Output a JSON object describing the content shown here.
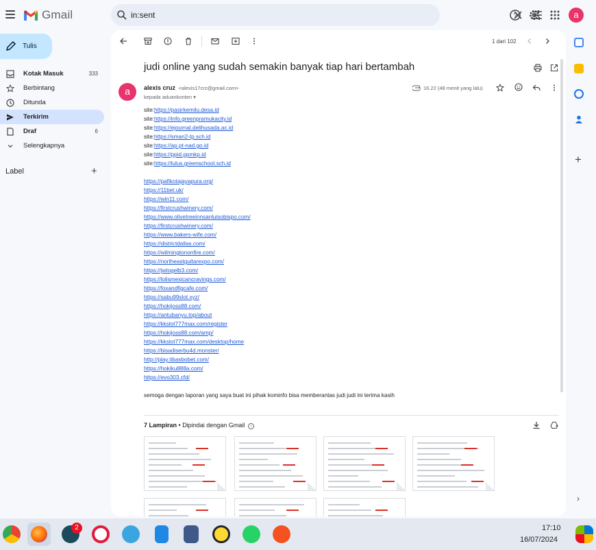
{
  "app": {
    "name": "Gmail",
    "avatar_letter": "a"
  },
  "search": {
    "value": "in:sent"
  },
  "compose": {
    "label": "Tulis"
  },
  "nav": [
    {
      "label": "Kotak Masuk",
      "count": "333",
      "icon": "inbox-icon",
      "bold": true,
      "active": false
    },
    {
      "label": "Berbintang",
      "count": "",
      "icon": "star-icon",
      "bold": false,
      "active": false
    },
    {
      "label": "Ditunda",
      "count": "",
      "icon": "clock-icon",
      "bold": false,
      "active": false
    },
    {
      "label": "Terkirim",
      "count": "",
      "icon": "send-icon",
      "bold": true,
      "active": true
    },
    {
      "label": "Draf",
      "count": "6",
      "icon": "draft-icon",
      "bold": true,
      "active": false
    },
    {
      "label": "Selengkapnya",
      "count": "",
      "icon": "chevron-down-icon",
      "bold": false,
      "active": false
    }
  ],
  "labels": {
    "heading": "Label"
  },
  "pager": {
    "text": "1 dari 102"
  },
  "email": {
    "subject": "judi online yang sudah semakin banyak tiap hari bertambah",
    "sender_name": "alexis cruz",
    "sender_email": "<alexis17crz@gmail.com>",
    "recipient": "kepada aduankonten",
    "time": "16.22 (48 menit yang lalu)",
    "avatar_letter": "a",
    "site_lines": [
      {
        "prefix": "site:",
        "url": "https://pasirkemilu.desa.id"
      },
      {
        "prefix": "site:",
        "url": "https://info.greenpramukacity.id"
      },
      {
        "prefix": "site:",
        "url": "https://ejournal.delihusada.ac.id"
      },
      {
        "prefix": "site:",
        "url": "https://sman2-tp.sch.id"
      },
      {
        "prefix": "site:",
        "url": "https://ap.pt-nad.go.id"
      },
      {
        "prefix": "site:",
        "url": "https://ppid.ppmkp.id"
      },
      {
        "prefix": "site:",
        "url": "https://lulus.greenschool.sch.id"
      }
    ],
    "links": [
      "https://pafikotajayapura.org/",
      "https://11bet.uk/",
      "https://win11.com/",
      "https://firstcrushwinery.com/",
      "https://www.olivetreeinnsanluisobispo.com/",
      "https://firstcrushwinery.com/",
      "https://www.bakers-wife.com/",
      "https://districtdallas.com/",
      "https://wilmingtononfire.com/",
      "https://northeastguitarexpo.com/",
      "https://jwtogelb3.com/",
      "https://lolismexicancravings.com/",
      "https://foxandfigcafe.com/",
      "https://sabu99slot.xyz/",
      "https://hokijoss88.com/",
      "https://antubanyu.top/about",
      "https://kkslot777max.com/register",
      "https://hokijoss88.com/amp/",
      "https://kkslot777max.com/desktop/home",
      "https://bisadiserbu4d.monster/",
      "http://play.tibasbobet.com/",
      "https://hokiku888a.com/",
      "https://evo303.cfd/"
    ],
    "closing": "semoga dengan laporan yang saya buat ini pihak kominfo bisa memberantas judi judi ini terima kasih"
  },
  "attachments": {
    "count_label": "7 Lampiran",
    "scan_label": "Dipindai dengan Gmail",
    "count": 7
  },
  "taskbar": {
    "badge": "2",
    "time": "17:10",
    "date": "16/07/2024"
  },
  "colors": {
    "accent": "#c2e7ff",
    "active_nav": "#d3e3fd",
    "avatar": "#e8336d",
    "link": "#1a57d6"
  }
}
